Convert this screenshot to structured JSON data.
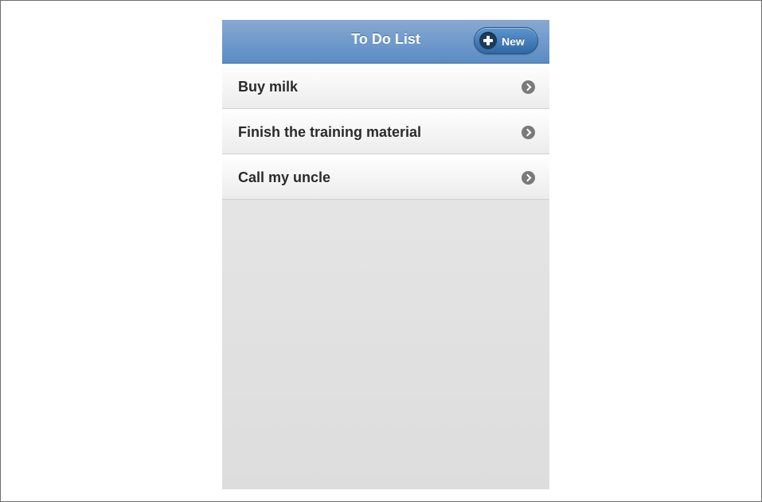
{
  "header": {
    "title": "To Do List",
    "new_button_label": "New",
    "new_button_icon": "plus-circle-icon"
  },
  "todo_items": [
    {
      "label": "Buy milk",
      "icon": "chevron-right-icon"
    },
    {
      "label": "Finish the training material",
      "icon": "chevron-right-icon"
    },
    {
      "label": "Call my uncle",
      "icon": "chevron-right-icon"
    }
  ],
  "colors": {
    "header_accent": "#5a8cc4",
    "button_accent": "#2f6aa8",
    "background": "#e3e3e3"
  }
}
